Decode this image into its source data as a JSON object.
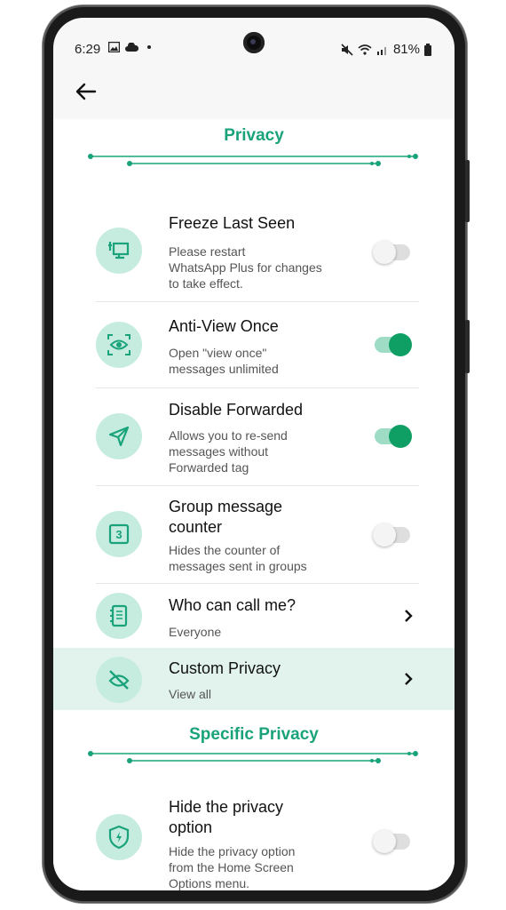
{
  "status": {
    "time": "6:29",
    "battery": "81%"
  },
  "appbar": {
    "back_icon": "arrow-left-icon"
  },
  "colors": {
    "accent": "#1aa37a",
    "toggle_on": "#0f9e63",
    "icon_bg": "#c6ece0",
    "highlight": "#e1f3ec"
  },
  "sections": {
    "privacy": {
      "title": "Privacy",
      "items": [
        {
          "title": "Freeze Last Seen",
          "subtitle": "Please restart\nWhatsApp Plus for changes\nto take effect.",
          "icon": "monitor-plug-icon",
          "control": "toggle",
          "enabled": false
        },
        {
          "title": "Anti-View Once",
          "subtitle": "Open \"view once\"\nmessages unlimited",
          "icon": "eye-scan-icon",
          "control": "toggle",
          "enabled": true
        },
        {
          "title": "Disable Forwarded",
          "subtitle": "Allows you to re-send\nmessages without\nForwarded tag",
          "icon": "send-icon",
          "control": "toggle",
          "enabled": true
        },
        {
          "title": "Group message\ncounter",
          "subtitle": "Hides the counter of\nmessages sent in groups",
          "icon": "counter-icon",
          "control": "toggle",
          "enabled": false
        },
        {
          "title": "Who can call me?",
          "subtitle": "Everyone",
          "icon": "phone-book-icon",
          "control": "chevron"
        },
        {
          "title": "Custom Privacy",
          "subtitle": "View all",
          "icon": "eye-off-icon",
          "control": "chevron",
          "highlighted": true
        }
      ]
    },
    "specific": {
      "title": "Specific Privacy",
      "items": [
        {
          "title": "Hide the privacy\noption",
          "subtitle": "Hide the privacy option\nfrom the Home Screen\nOptions menu.",
          "icon": "shield-bolt-icon",
          "control": "toggle",
          "enabled": false
        }
      ]
    }
  }
}
